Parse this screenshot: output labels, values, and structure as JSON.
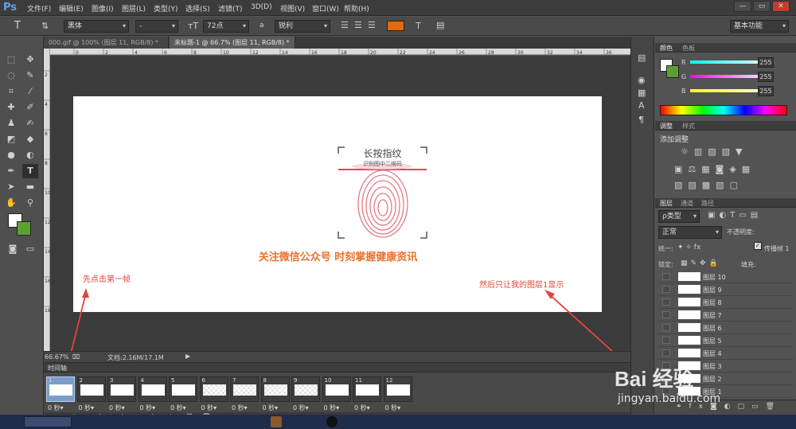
{
  "app": {
    "logo": "Ps"
  },
  "menu": [
    "文件(F)",
    "编辑(E)",
    "图像(I)",
    "图层(L)",
    "类型(Y)",
    "选择(S)",
    "滤镜(T)",
    "3D(D)",
    "视图(V)",
    "窗口(W)",
    "帮助(H)"
  ],
  "window_controls": {
    "minimize": "—",
    "restore": "▭",
    "close": "✕"
  },
  "options": {
    "font_family": "黑体",
    "font_style": "-",
    "font_size": "72点",
    "aa_label": "a",
    "antialias": "锐利",
    "text_color": "#e06a10",
    "workspace": "基本功能"
  },
  "tabs": [
    {
      "label": "000.gif @ 100% (图层 11, RGB/8) *",
      "active": false
    },
    {
      "label": "未标题-1 @ 66.7% (图层 11, RGB/8) *",
      "active": true
    }
  ],
  "rulers": {
    "h": [
      "0",
      "2",
      "4",
      "6",
      "8",
      "10",
      "12",
      "14",
      "16",
      "18",
      "20",
      "22",
      "24",
      "26",
      "28",
      "30",
      "32",
      "34",
      "36",
      "38"
    ],
    "v": [
      "2",
      "4",
      "6",
      "8",
      "10",
      "12",
      "14",
      "16",
      "18"
    ]
  },
  "canvas": {
    "card_title": "长按指纹",
    "card_sub": "识别图中二维码",
    "headline": "关注微信公众号  时刻掌握健康资讯",
    "headline_color": "#e8722a"
  },
  "status": {
    "zoom": "66.67%",
    "doc": "文档:2.16M/17.1M"
  },
  "timeline": {
    "title": "时间轴",
    "frames": [
      {
        "num": "1",
        "dur": "0 秒▾"
      },
      {
        "num": "2",
        "dur": "0 秒▾"
      },
      {
        "num": "3",
        "dur": "0 秒▾"
      },
      {
        "num": "4",
        "dur": "0 秒▾"
      },
      {
        "num": "5",
        "dur": "0 秒▾"
      },
      {
        "num": "6",
        "dur": "0 秒▾"
      },
      {
        "num": "7",
        "dur": "0 秒▾"
      },
      {
        "num": "8",
        "dur": "0 秒▾"
      },
      {
        "num": "9",
        "dur": "0 秒▾"
      },
      {
        "num": "10",
        "dur": "0 秒▾"
      },
      {
        "num": "11",
        "dur": "0 秒▾"
      },
      {
        "num": "12",
        "dur": "0 秒▾"
      }
    ],
    "loop": "一次"
  },
  "color_panel": {
    "tabs": [
      "颜色",
      "色板"
    ],
    "channels": [
      {
        "name": "R",
        "value": "255"
      },
      {
        "name": "G",
        "value": "255"
      },
      {
        "name": "B",
        "value": "255"
      }
    ]
  },
  "adjust_panel": {
    "tabs": [
      "调整",
      "样式"
    ],
    "heading": "添加调整"
  },
  "layers_panel": {
    "tabs": [
      "图层",
      "通道",
      "路径"
    ],
    "filter": "ρ类型",
    "blend": "正常",
    "opacity_label": "不透明度:",
    "unify_label": "统一:",
    "propagate": "传播帧 1",
    "lock_label": "锁定:",
    "fill_label": "填充:",
    "layers": [
      "图层 10",
      "图层 9",
      "图层 8",
      "图层 7",
      "图层 6",
      "图层 5",
      "图层 4",
      "图层 3",
      "图层 2",
      "图层 1"
    ]
  },
  "annotations": {
    "left": "先点击第一帧",
    "right": "然后只让我的图层1显示",
    "color": "#e0463a"
  },
  "watermark": {
    "brand": "Bai 经验",
    "url": "jingyan.baidu.com"
  }
}
